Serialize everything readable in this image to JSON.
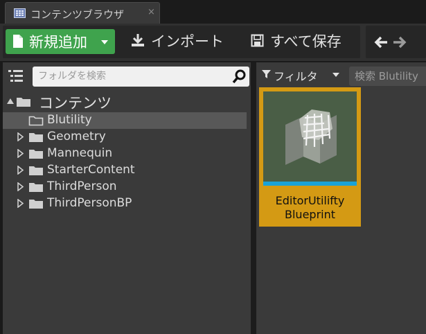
{
  "tab": {
    "title": "コンテンツブラウザ",
    "close_glyph": "×"
  },
  "toolbar": {
    "add_new_label": "新規追加",
    "import_label": "インポート",
    "save_all_label": "すべて保存"
  },
  "sources": {
    "search_placeholder": "フォルダを検索",
    "root_label": "コンテンツ",
    "folders": [
      {
        "label": "Blutility",
        "selected": true,
        "has_children": false
      },
      {
        "label": "Geometry",
        "selected": false,
        "has_children": true
      },
      {
        "label": "Mannequin",
        "selected": false,
        "has_children": true
      },
      {
        "label": "StarterContent",
        "selected": false,
        "has_children": true
      },
      {
        "label": "ThirdPerson",
        "selected": false,
        "has_children": true
      },
      {
        "label": "ThirdPersonBP",
        "selected": false,
        "has_children": true
      }
    ]
  },
  "assets": {
    "filter_label": "フィルタ",
    "search_placeholder": "検索 Blutility",
    "items": [
      {
        "name": "EditorUtilifty Blueprint",
        "selected": true
      }
    ]
  },
  "colors": {
    "add_button": "#3fa34d",
    "selection": "#d49a14",
    "asset_type_bar": "#1aa3d8",
    "thumbnail_bg": "#4a5e46"
  }
}
